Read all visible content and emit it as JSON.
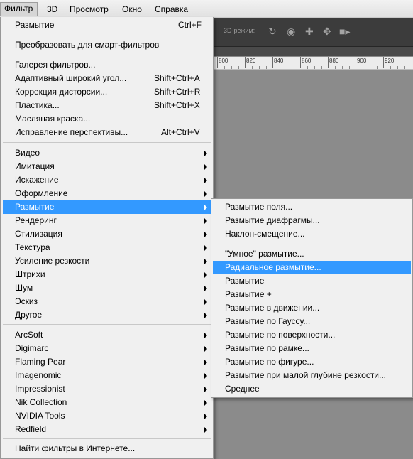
{
  "menubar": {
    "items": [
      {
        "label": "Фильтр",
        "accel": "Ф"
      },
      {
        "label": "3D",
        "accel": "3"
      },
      {
        "label": "Просмотр",
        "accel": "П"
      },
      {
        "label": "Окно",
        "accel": "О"
      },
      {
        "label": "Справка",
        "accel": "С"
      }
    ]
  },
  "options_bar": {
    "mode_label": "3D-режим:"
  },
  "ruler": {
    "labels": [
      "800",
      "820",
      "840",
      "860",
      "880",
      "900",
      "920"
    ]
  },
  "filter_menu": {
    "groups": [
      [
        {
          "label": "Размытие",
          "shortcut": "Ctrl+F"
        }
      ],
      [
        {
          "label": "Преобразовать для смарт-фильтров"
        }
      ],
      [
        {
          "label": "Галерея фильтров..."
        },
        {
          "label": "Адаптивный широкий угол...",
          "shortcut": "Shift+Ctrl+A"
        },
        {
          "label": "Коррекция дисторсии...",
          "shortcut": "Shift+Ctrl+R"
        },
        {
          "label": "Пластика...",
          "shortcut": "Shift+Ctrl+X"
        },
        {
          "label": "Масляная краска..."
        },
        {
          "label": "Исправление перспективы...",
          "shortcut": "Alt+Ctrl+V"
        }
      ],
      [
        {
          "label": "Видео",
          "submenu": true
        },
        {
          "label": "Имитация",
          "submenu": true
        },
        {
          "label": "Искажение",
          "submenu": true
        },
        {
          "label": "Оформление",
          "submenu": true
        },
        {
          "label": "Размытие",
          "submenu": true,
          "highlighted": true
        },
        {
          "label": "Рендеринг",
          "submenu": true
        },
        {
          "label": "Стилизация",
          "submenu": true
        },
        {
          "label": "Текстура",
          "submenu": true
        },
        {
          "label": "Усиление резкости",
          "submenu": true
        },
        {
          "label": "Штрихи",
          "submenu": true
        },
        {
          "label": "Шум",
          "submenu": true
        },
        {
          "label": "Эскиз",
          "submenu": true
        },
        {
          "label": "Другое",
          "submenu": true
        }
      ],
      [
        {
          "label": "ArcSoft",
          "submenu": true
        },
        {
          "label": "Digimarc",
          "submenu": true
        },
        {
          "label": "Flaming Pear",
          "submenu": true
        },
        {
          "label": "Imagenomic",
          "submenu": true
        },
        {
          "label": "Impressionist",
          "submenu": true
        },
        {
          "label": "Nik Collection",
          "submenu": true
        },
        {
          "label": "NVIDIA Tools",
          "submenu": true
        },
        {
          "label": "Redfield",
          "submenu": true
        }
      ],
      [
        {
          "label": "Найти фильтры в Интернете..."
        }
      ]
    ]
  },
  "blur_submenu": {
    "groups": [
      [
        {
          "label": "Размытие поля..."
        },
        {
          "label": "Размытие диафрагмы..."
        },
        {
          "label": "Наклон-смещение..."
        }
      ],
      [
        {
          "label": "\"Умное\" размытие..."
        },
        {
          "label": "Радиальное размытие...",
          "highlighted": true
        },
        {
          "label": "Размытие"
        },
        {
          "label": "Размытие +"
        },
        {
          "label": "Размытие в движении..."
        },
        {
          "label": "Размытие по Гауссу..."
        },
        {
          "label": "Размытие по поверхности..."
        },
        {
          "label": "Размытие по рамке..."
        },
        {
          "label": "Размытие по фигуре..."
        },
        {
          "label": "Размытие при малой глубине резкости..."
        },
        {
          "label": "Среднее"
        }
      ]
    ]
  },
  "colors": {
    "highlight": "#3399ff",
    "menu_bg": "#f0f0f0",
    "app_bg": "#8a8a8a"
  }
}
